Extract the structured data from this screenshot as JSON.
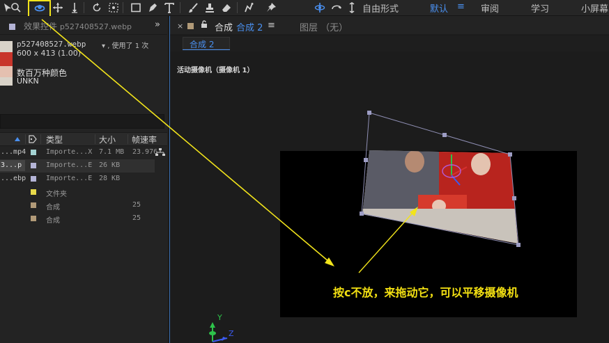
{
  "toolbar": {
    "tools": [
      "selection-tool",
      "hand-tool",
      "zoom-tool",
      "orbit-camera-tool",
      "pan-camera-tool",
      "dolly-camera-tool",
      "rotate-tool",
      "pan-behind-tool",
      "rectangle-tool",
      "pen-tool",
      "text-tool",
      "brush-tool",
      "clone-stamp-tool",
      "eraser-tool",
      "roto-brush-tool",
      "puppet-pin-tool"
    ],
    "axis_mode_label": "自由形式",
    "workspaces": [
      "默认",
      "审阅",
      "学习",
      "小屏幕"
    ],
    "workspace_menu_icon": "≡",
    "active_workspace": "默认"
  },
  "left_panel": {
    "tab_title": "效果控件",
    "tab_file": "p527408527.webp",
    "chevron": "»",
    "file_name": "p527408527.webp",
    "file_usage": "▾ , 使用了 1 次",
    "file_dimensions": "600 x 413 (1.00)",
    "colors": "数百万种颜色",
    "codec": "UNKN",
    "columns": [
      "类型",
      "大小",
      "帧速率"
    ],
    "rows": [
      {
        "name": "...mp4",
        "type": "Importe...X",
        "size": "7.1 MB",
        "fps": "23.976",
        "label_color": "#a3d2d2",
        "selected": false
      },
      {
        "name": "3...p",
        "type": "Importe...E",
        "size": "26 KB",
        "fps": "",
        "label_color": "#b4b4d6",
        "selected": true
      },
      {
        "name": "...ebp",
        "type": "Importe...E",
        "size": "28 KB",
        "fps": "",
        "label_color": "#b4b4d6",
        "selected": false
      },
      {
        "name": "",
        "type": "文件夹",
        "size": "",
        "fps": "",
        "label_color": "#e8d94a",
        "selected": false
      },
      {
        "name": "",
        "type": "合成",
        "size": "",
        "fps": "25",
        "label_color": "#b19a78",
        "selected": false
      },
      {
        "name": "",
        "type": "合成",
        "size": "",
        "fps": "25",
        "label_color": "#b19a78",
        "selected": false
      }
    ]
  },
  "composition_panel": {
    "close": "×",
    "lock": "🔓",
    "tab_label": "合成",
    "tab_active": "合成 2",
    "menu": "≡",
    "layer_tab": "图层 （无）",
    "nav_comp": "合成 2",
    "camera_label": "活动摄像机（摄像机 1）",
    "axis_y": "Y",
    "axis_z": "Z"
  },
  "annotation": {
    "text": "按c不放，来拖动它，可以平移摄像机",
    "color": "#f3e012"
  },
  "colors": {
    "accent_blue": "#4a90f0",
    "highlight_yellow": "#f2e41b"
  }
}
